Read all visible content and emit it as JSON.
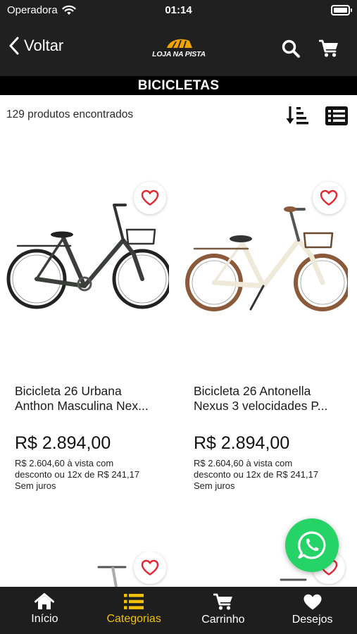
{
  "status_bar": {
    "carrier": "Operadora",
    "time": "01:14"
  },
  "header": {
    "back_label": "Voltar",
    "logo_text": "LOJA NA PISTA"
  },
  "category": {
    "title": "BICICLETAS"
  },
  "results": {
    "count_text": "129 produtos encontrados"
  },
  "products": [
    {
      "name_line1": "Bicicleta 26 Urbana",
      "name_line2": "Anthon Masculina Nex...",
      "price": "R$ 2.894,00",
      "installments_line1": "R$ 2.604,60 à vista com",
      "installments_line2": "desconto ou 12x de R$ 241,17",
      "installments_line3": "Sem juros",
      "frame_color": "#3a3f3a"
    },
    {
      "name_line1": "Bicicleta 26 Antonella",
      "name_line2": "Nexus 3 velocidades P...",
      "price": "R$ 2.894,00",
      "installments_line1": "R$ 2.604,60 à vista com",
      "installments_line2": "desconto ou 12x de R$ 241,17",
      "installments_line3": "Sem juros",
      "frame_color": "#efe9da"
    }
  ],
  "bottom_nav": {
    "items": [
      {
        "label": "Início",
        "icon": "home-icon"
      },
      {
        "label": "Categorias",
        "icon": "list-icon",
        "active": true
      },
      {
        "label": "Carrinho",
        "icon": "cart-icon"
      },
      {
        "label": "Desejos",
        "icon": "heart-icon"
      }
    ]
  },
  "colors": {
    "accent": "#f2c200",
    "dark_bar": "#202020",
    "heart": "#e3262f",
    "whatsapp": "#25d366"
  }
}
